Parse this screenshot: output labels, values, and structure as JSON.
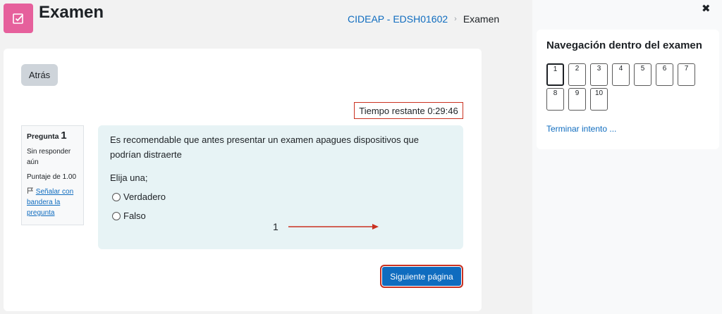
{
  "header": {
    "title": "Examen",
    "breadcrumb": {
      "course": "CIDEAP - EDSH01602",
      "separator": "›",
      "current": "Examen"
    },
    "icon": "quiz-icon",
    "icon_color": "#e6609c"
  },
  "quiz": {
    "back_label": "Atrás",
    "timer_label": "Tiempo restante",
    "timer_value": "0:29:46",
    "timer_text": "Tiempo restante 0:29:46",
    "question": {
      "label": "Pregunta",
      "number": "1",
      "status": "Sin responder aún",
      "score": "Puntaje de 1.00",
      "flag_label": "Señalar con bandera la pregunta",
      "text": "Es recomendable que antes presentar un examen apagues dispositivos que podrían distraerte",
      "prompt": "Elija una;",
      "options": [
        "Verdadero",
        "Falso"
      ]
    },
    "next_label": "Siguiente página",
    "annotation_number": "1"
  },
  "navigation": {
    "title": "Navegación dentro del examen",
    "questions": [
      "1",
      "2",
      "3",
      "4",
      "5",
      "6",
      "7",
      "8",
      "9",
      "10"
    ],
    "current": "1",
    "finish_label": "Terminar intento ..."
  },
  "colors": {
    "primary": "#0f6cbf",
    "highlight": "#ca3120",
    "question_bg": "#e7f3f5"
  }
}
